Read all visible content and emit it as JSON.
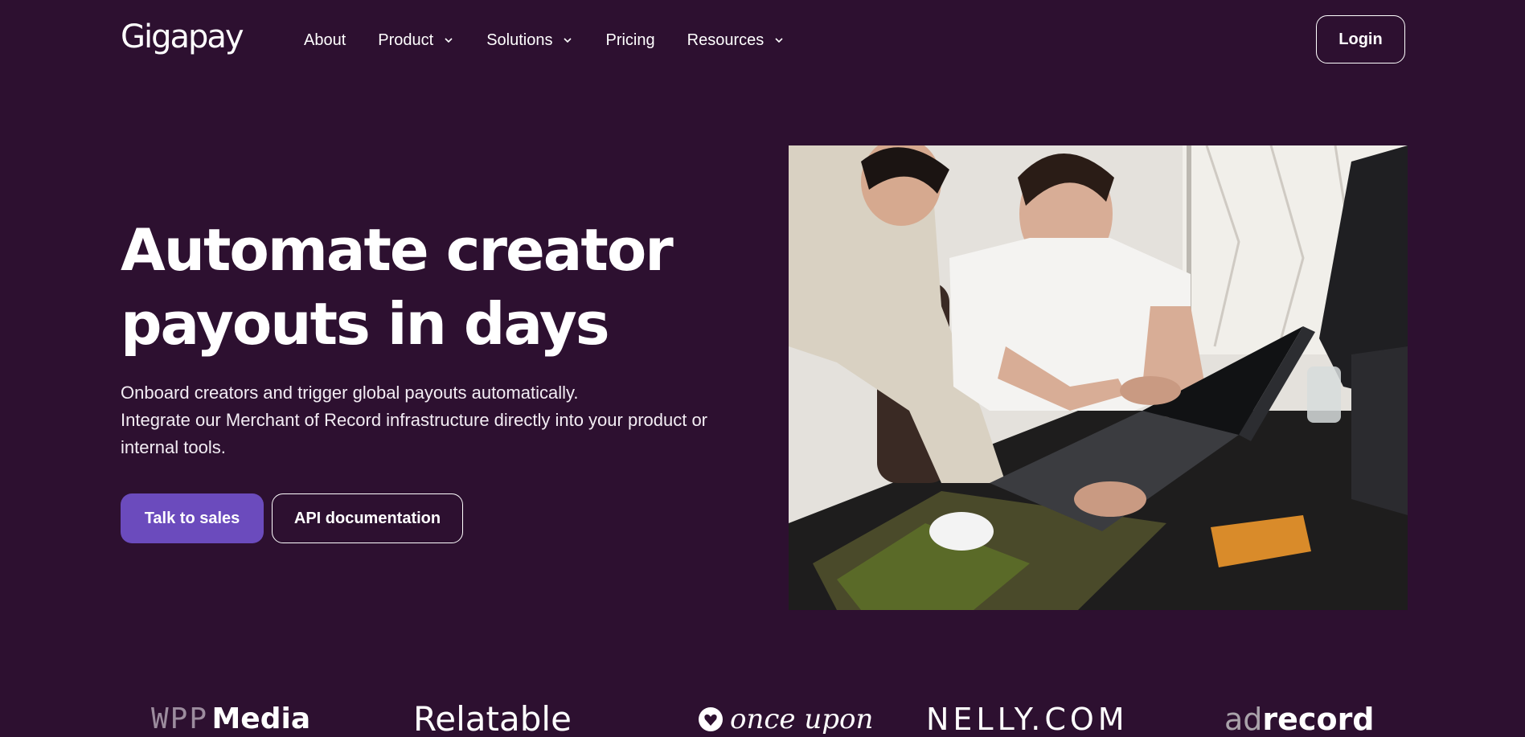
{
  "brand": {
    "logo_text": "Gigapay"
  },
  "nav": {
    "items": [
      {
        "label": "About",
        "has_dropdown": false
      },
      {
        "label": "Product",
        "has_dropdown": true
      },
      {
        "label": "Solutions",
        "has_dropdown": true
      },
      {
        "label": "Pricing",
        "has_dropdown": false
      },
      {
        "label": "Resources",
        "has_dropdown": true
      }
    ],
    "login_label": "Login"
  },
  "hero": {
    "headline_line1": "Automate creator",
    "headline_line2": "payouts in days",
    "subtext_line1": "Onboard creators and trigger global payouts automatically.",
    "subtext_line2": "Integrate our Merchant of Record infrastructure directly into your product or internal tools.",
    "primary_cta": "Talk to sales",
    "secondary_cta": "API documentation"
  },
  "logos": {
    "wpp_part": "WPP",
    "media_part": "Media",
    "relatable": "Relatable",
    "once_upon": "once upon",
    "nelly": "NELLY.COM",
    "ad_part": "ad",
    "record_part": "record"
  },
  "colors": {
    "background": "#2d1030",
    "primary_button": "#6b4bbd",
    "text": "#ffffff"
  },
  "icons": {
    "dropdown": "chevron-down-icon"
  }
}
